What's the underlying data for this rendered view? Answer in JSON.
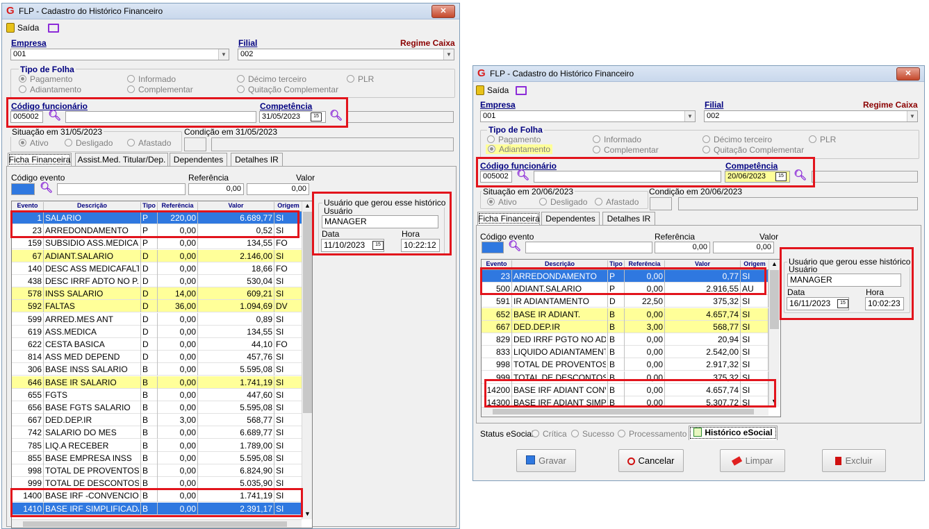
{
  "left": {
    "title": "FLP - Cadastro do Histórico Financeiro",
    "close": "✕",
    "saida": "Saída",
    "empresa_label": "Empresa",
    "empresa_value": "001",
    "filial_label": "Filial",
    "filial_value": "002",
    "regime": "Regime Caixa",
    "tipo_folha_label": "Tipo de Folha",
    "radios": [
      "Pagamento",
      "Informado",
      "Décimo terceiro",
      "PLR",
      "Adiantamento",
      "Complementar",
      "Quitação Complementar"
    ],
    "cod_func_label": "Código funcionário",
    "cod_func_value": "005002",
    "competencia_label": "Competência",
    "competencia_value": "31/05/2023",
    "situacao_label": "Situação em  31/05/2023",
    "condicao_label": "Condição em 31/05/2023",
    "sit_radios": [
      "Ativo",
      "Desligado",
      "Afastado"
    ],
    "tabs": [
      "Ficha Financeira",
      "Assist.Med. Titular/Dep.",
      "Dependentes",
      "Detalhes IR"
    ],
    "cod_evento_label": "Código evento",
    "referencia_label": "Referência",
    "valor_label": "Valor",
    "referencia_value": "0,00",
    "valor_value": "0,00",
    "headers": [
      "Evento",
      "Descrição",
      "Tipo",
      "Referência",
      "Valor",
      "Origem"
    ],
    "rows": [
      [
        "1",
        "SALARIO",
        "P",
        "220,00",
        "6.689,77",
        "SI",
        "sel"
      ],
      [
        "23",
        "ARREDONDAMENTO",
        "P",
        "0,00",
        "0,52",
        "SI",
        ""
      ],
      [
        "159",
        "SUBSIDIO ASS.MEDICA",
        "P",
        "0,00",
        "134,55",
        "FO",
        ""
      ],
      [
        "67",
        "ADIANT.SALARIO",
        "D",
        "0,00",
        "2.146,00",
        "SI",
        "yel"
      ],
      [
        "140",
        "DESC ASS MEDICAFALTA",
        "D",
        "0,00",
        "18,66",
        "FO",
        ""
      ],
      [
        "438",
        "DESC IRRF ADTO NO P...",
        "D",
        "0,00",
        "530,04",
        "SI",
        ""
      ],
      [
        "578",
        "INSS SALARIO",
        "D",
        "14,00",
        "609,21",
        "SI",
        "yel"
      ],
      [
        "592",
        "FALTAS",
        "D",
        "36,00",
        "1.094,69",
        "DV",
        "yel"
      ],
      [
        "599",
        "ARRED.MES ANT",
        "D",
        "0,00",
        "0,89",
        "SI",
        ""
      ],
      [
        "619",
        "ASS.MEDICA",
        "D",
        "0,00",
        "134,55",
        "SI",
        ""
      ],
      [
        "622",
        "CESTA BASICA",
        "D",
        "0,00",
        "44,10",
        "FO",
        ""
      ],
      [
        "814",
        "ASS MED DEPEND",
        "D",
        "0,00",
        "457,76",
        "SI",
        ""
      ],
      [
        "306",
        "BASE INSS SALARIO",
        "B",
        "0,00",
        "5.595,08",
        "SI",
        ""
      ],
      [
        "646",
        "BASE IR SALARIO",
        "B",
        "0,00",
        "1.741,19",
        "SI",
        "yel"
      ],
      [
        "655",
        "FGTS",
        "B",
        "0,00",
        "447,60",
        "SI",
        ""
      ],
      [
        "656",
        "BASE FGTS SALARIO",
        "B",
        "0,00",
        "5.595,08",
        "SI",
        ""
      ],
      [
        "667",
        "DED.DEP.IR",
        "B",
        "3,00",
        "568,77",
        "SI",
        ""
      ],
      [
        "742",
        "SALARIO DO MES",
        "B",
        "0,00",
        "6.689,77",
        "SI",
        ""
      ],
      [
        "785",
        "LIQ.A RECEBER",
        "B",
        "0,00",
        "1.789,00",
        "SI",
        ""
      ],
      [
        "855",
        "BASE EMPRESA INSS",
        "B",
        "0,00",
        "5.595,08",
        "SI",
        ""
      ],
      [
        "998",
        "TOTAL DE PROVENTOS",
        "B",
        "0,00",
        "6.824,90",
        "SI",
        ""
      ],
      [
        "999",
        "TOTAL DE DESCONTOS",
        "B",
        "0,00",
        "5.035,90",
        "SI",
        ""
      ],
      [
        "1400",
        "BASE IRF -CONVENCION...",
        "B",
        "0,00",
        "1.741,19",
        "SI",
        ""
      ],
      [
        "1410",
        "BASE IRF SIMPLIFICADA",
        "B",
        "0,00",
        "2.391,17",
        "SI",
        "sel"
      ]
    ],
    "user_group": "Usuário que gerou esse histórico",
    "usuario_label": "Usuário",
    "usuario_value": "MANAGER",
    "data_label": "Data",
    "data_value": "11/10/2023",
    "hora_label": "Hora",
    "hora_value": "10:22:12"
  },
  "right": {
    "title": "FLP - Cadastro do Histórico Financeiro",
    "close": "✕",
    "saida": "Saída",
    "empresa_label": "Empresa",
    "empresa_value": "001",
    "filial_label": "Filial",
    "filial_value": "002",
    "regime": "Regime Caixa",
    "tipo_folha_label": "Tipo de Folha",
    "radios": [
      "Pagamento",
      "Informado",
      "Décimo terceiro",
      "PLR",
      "Adiantamento",
      "Complementar",
      "Quitação Complementar"
    ],
    "cod_func_label": "Código funcionário",
    "cod_func_value": "005002",
    "competencia_label": "Competência",
    "competencia_value": "20/06/2023",
    "situacao_label": "Situação em  20/06/2023",
    "condicao_label": "Condição em 20/06/2023",
    "sit_radios": [
      "Ativo",
      "Desligado",
      "Afastado"
    ],
    "tabs": [
      "Ficha Financeira",
      "Dependentes",
      "Detalhes IR"
    ],
    "cod_evento_label": "Código evento",
    "referencia_label": "Referência",
    "valor_label": "Valor",
    "referencia_value": "0,00",
    "valor_value": "0,00",
    "headers": [
      "Evento",
      "Descrição",
      "Tipo",
      "Referência",
      "Valor",
      "Origem"
    ],
    "rows": [
      [
        "23",
        "ARREDONDAMENTO",
        "P",
        "0,00",
        "0,77",
        "SI",
        "sel"
      ],
      [
        "500",
        "ADIANT.SALARIO",
        "P",
        "0,00",
        "2.916,55",
        "AU",
        ""
      ],
      [
        "591",
        "IR ADIANTAMENTO",
        "D",
        "22,50",
        "375,32",
        "SI",
        ""
      ],
      [
        "652",
        "BASE IR ADIANT.",
        "B",
        "0,00",
        "4.657,74",
        "SI",
        "yel"
      ],
      [
        "667",
        "DED.DEP.IR",
        "B",
        "3,00",
        "568,77",
        "SI",
        "yel"
      ],
      [
        "829",
        "DED IRRF PGTO NO AD...",
        "B",
        "0,00",
        "20,94",
        "SI",
        ""
      ],
      [
        "833",
        "LIQUIDO ADIANTAMENTO",
        "B",
        "0,00",
        "2.542,00",
        "SI",
        ""
      ],
      [
        "998",
        "TOTAL DE PROVENTOS",
        "B",
        "0,00",
        "2.917,32",
        "SI",
        ""
      ],
      [
        "999",
        "TOTAL DE DESCONTOS",
        "B",
        "0,00",
        "375,32",
        "SI",
        ""
      ],
      [
        "14200",
        "BASE IRF ADIANT CONV",
        "B",
        "0,00",
        "4.657,74",
        "SI",
        ""
      ],
      [
        "14300",
        "BASE IRF ADIANT SIMPLI",
        "B",
        "0,00",
        "5.307,72",
        "SI",
        ""
      ]
    ],
    "user_group": "Usuário que gerou esse histórico",
    "usuario_label": "Usuário",
    "usuario_value": "MANAGER",
    "data_label": "Data",
    "data_value": "16/11/2023",
    "hora_label": "Hora",
    "hora_value": "10:02:23",
    "status_label": "Status eSocial:",
    "status_radios": [
      "Crítica",
      "Sucesso",
      "Processamento"
    ],
    "hist_esocial": "Histórico eSocial",
    "buttons": [
      "Gravar",
      "Cancelar",
      "Limpar",
      "Excluir"
    ]
  }
}
